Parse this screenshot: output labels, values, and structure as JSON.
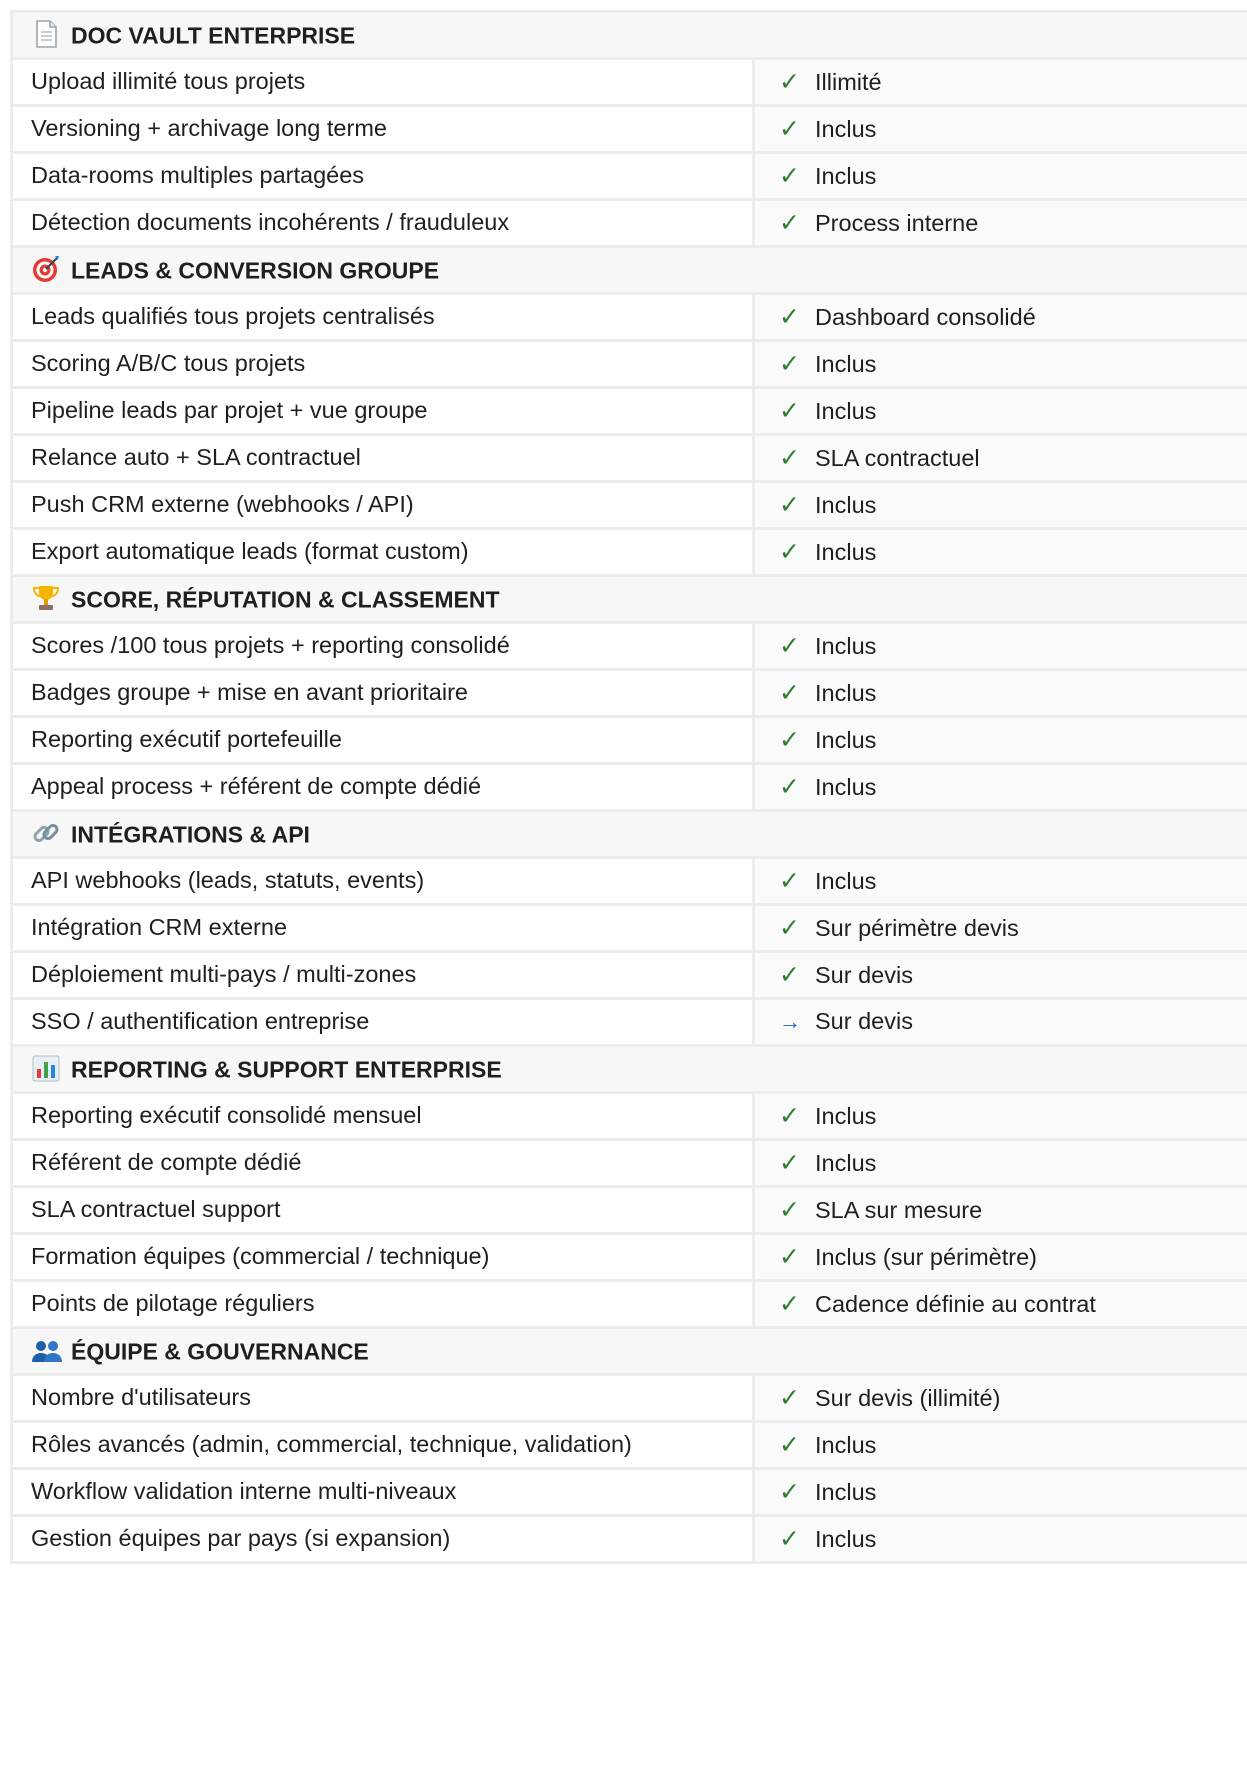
{
  "sections": [
    {
      "icon": "document-icon",
      "title": "DOC VAULT ENTERPRISE",
      "rows": [
        {
          "feature": "Upload illimité tous projets",
          "mark": "✓",
          "value": "Illimité"
        },
        {
          "feature": "Versioning + archivage long terme",
          "mark": "✓",
          "value": "Inclus"
        },
        {
          "feature": "Data-rooms multiples partagées",
          "mark": "✓",
          "value": "Inclus"
        },
        {
          "feature": "Détection documents incohérents / frauduleux",
          "mark": "✓",
          "value": "Process interne"
        }
      ]
    },
    {
      "icon": "target-icon",
      "title": "LEADS & CONVERSION GROUPE",
      "rows": [
        {
          "feature": "Leads qualifiés tous projets centralisés",
          "mark": "✓",
          "value": "Dashboard consolidé"
        },
        {
          "feature": "Scoring A/B/C tous projets",
          "mark": "✓",
          "value": "Inclus"
        },
        {
          "feature": "Pipeline leads par projet + vue groupe",
          "mark": "✓",
          "value": "Inclus"
        },
        {
          "feature": "Relance auto + SLA contractuel",
          "mark": "✓",
          "value": "SLA contractuel"
        },
        {
          "feature": "Push CRM externe (webhooks / API)",
          "mark": "✓",
          "value": "Inclus"
        },
        {
          "feature": "Export automatique leads (format custom)",
          "mark": "✓",
          "value": "Inclus"
        }
      ]
    },
    {
      "icon": "trophy-icon",
      "title": "SCORE, RÉPUTATION & CLASSEMENT",
      "rows": [
        {
          "feature": "Scores /100 tous projets + reporting consolidé",
          "mark": "✓",
          "value": "Inclus"
        },
        {
          "feature": "Badges groupe + mise en avant prioritaire",
          "mark": "✓",
          "value": "Inclus"
        },
        {
          "feature": "Reporting exécutif portefeuille",
          "mark": "✓",
          "value": "Inclus"
        },
        {
          "feature": "Appeal process + référent de compte dédié",
          "mark": "✓",
          "value": "Inclus"
        }
      ]
    },
    {
      "icon": "link-icon",
      "title": "INTÉGRATIONS & API",
      "rows": [
        {
          "feature": "API webhooks (leads, statuts, events)",
          "mark": "✓",
          "value": "Inclus"
        },
        {
          "feature": "Intégration CRM externe",
          "mark": "✓",
          "value": "Sur périmètre devis"
        },
        {
          "feature": "Déploiement multi-pays / multi-zones",
          "mark": "✓",
          "value": "Sur devis"
        },
        {
          "feature": "SSO / authentification entreprise",
          "mark": "→",
          "value": "Sur devis"
        }
      ]
    },
    {
      "icon": "bar-chart-icon",
      "title": "REPORTING & SUPPORT ENTERPRISE",
      "rows": [
        {
          "feature": "Reporting exécutif consolidé mensuel",
          "mark": "✓",
          "value": "Inclus"
        },
        {
          "feature": "Référent de compte dédié",
          "mark": "✓",
          "value": "Inclus"
        },
        {
          "feature": "SLA contractuel support",
          "mark": "✓",
          "value": "SLA sur mesure"
        },
        {
          "feature": "Formation équipes (commercial / technique)",
          "mark": "✓",
          "value": "Inclus (sur périmètre)"
        },
        {
          "feature": "Points de pilotage réguliers",
          "mark": "✓",
          "value": "Cadence définie au contrat"
        }
      ]
    },
    {
      "icon": "people-icon",
      "title": "ÉQUIPE & GOUVERNANCE",
      "rows": [
        {
          "feature": "Nombre d'utilisateurs",
          "mark": "✓",
          "value": "Sur devis (illimité)"
        },
        {
          "feature": "Rôles avancés (admin, commercial, technique, validation)",
          "mark": "✓",
          "value": "Inclus"
        },
        {
          "feature": "Workflow validation interne multi-niveaux",
          "mark": "✓",
          "value": "Inclus"
        },
        {
          "feature": "Gestion équipes par pays (si expansion)",
          "mark": "✓",
          "value": "Inclus"
        }
      ]
    }
  ],
  "colors": {
    "check": "#2e7d32",
    "arrow": "#1e5bd8",
    "section_bg": "#f7f7f7",
    "value_bg": "#fafafa",
    "border": "#ececec"
  }
}
